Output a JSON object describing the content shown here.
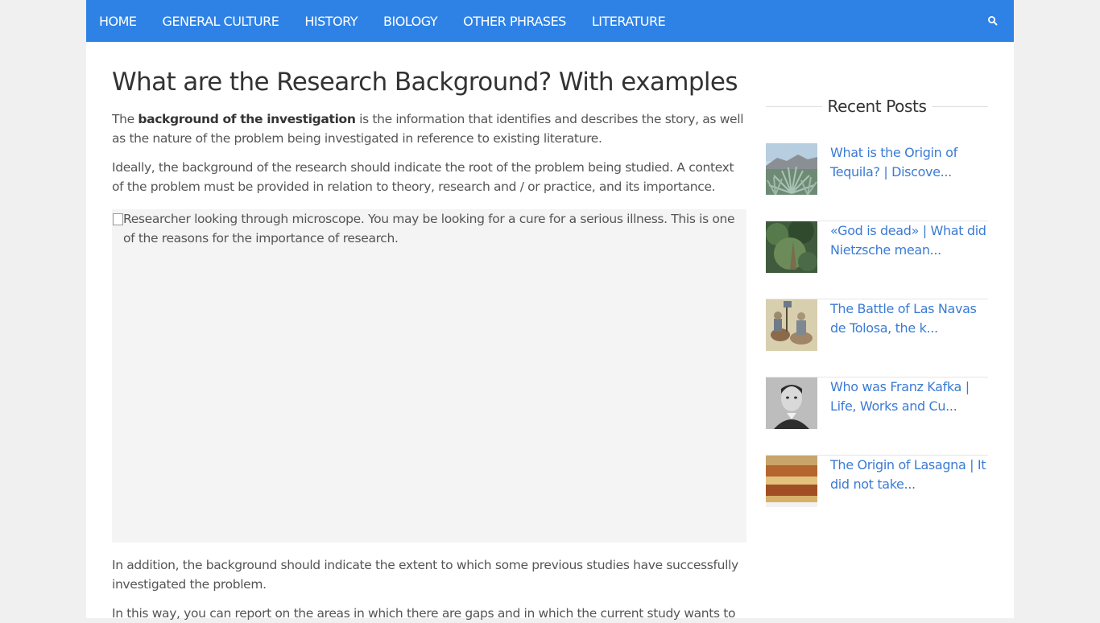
{
  "nav": {
    "items": [
      "HOME",
      "GENERAL CULTURE",
      "HISTORY",
      "BIOLOGY",
      "OTHER PHRASES",
      "LITERATURE"
    ]
  },
  "article": {
    "title": "What are the Research Background? With examples",
    "p1_pre": "The ",
    "p1_bold": "background of the investigation",
    "p1_post": " is the information that identifies and describes the story, as well as the nature of the problem being investigated in reference to existing literature.",
    "p2": "Ideally, the background of the research should indicate the root of the problem being studied. A context of the problem must be provided in relation to theory, research and / or practice, and its importance.",
    "image_alt": "Researcher looking through microscope. You may be looking for a cure for a serious illness. This is one of the reasons for the importance of research.",
    "p3": "In addition, the background should indicate the extent to which some previous studies have successfully investigated the problem.",
    "p4": "In this way, you can report on the areas in which there are gaps and in which the current study wants to"
  },
  "sidebar": {
    "title": "Recent Posts",
    "posts": [
      {
        "label": "What is the Origin of Tequila? | Discove...",
        "thumb": "agave-thumb"
      },
      {
        "label": "«God is dead» | What did Nietzsche mean...",
        "thumb": "forest-thumb"
      },
      {
        "label": "The Battle of Las Navas de Tolosa, the k...",
        "thumb": "knights-thumb"
      },
      {
        "label": "Who was Franz Kafka | Life, Works and Cu...",
        "thumb": "portrait-thumb"
      },
      {
        "label": "The Origin of Lasagna | It did not take...",
        "thumb": "lasagna-thumb"
      }
    ]
  },
  "colors": {
    "nav_bg": "#2e82e6",
    "link": "#3b7bd4",
    "page_bg": "#f0f0f0"
  }
}
